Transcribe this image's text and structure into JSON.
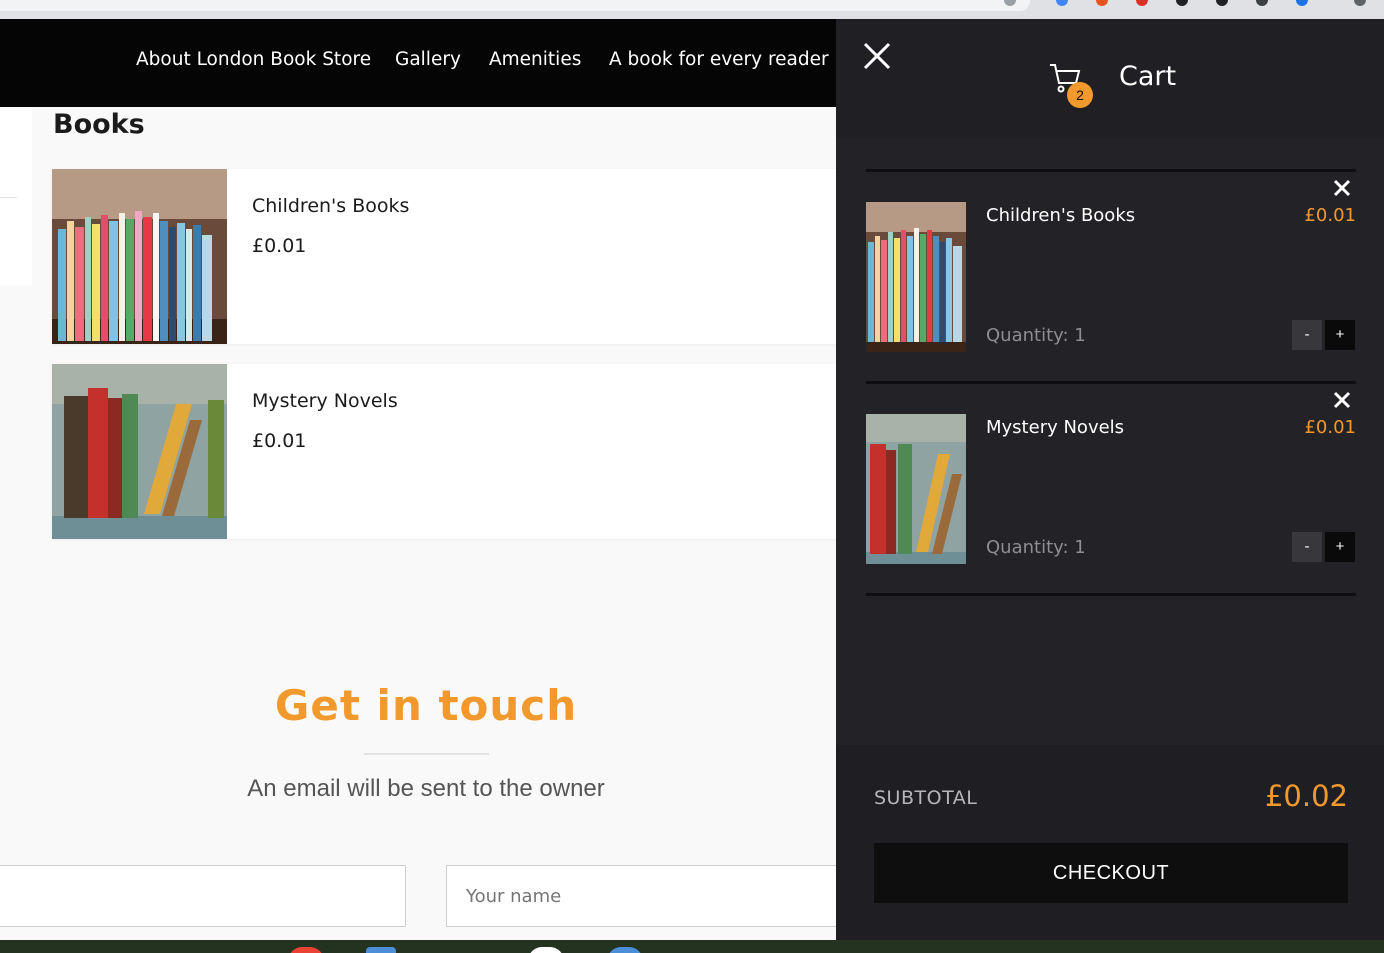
{
  "nav": {
    "items": [
      {
        "label": "About London Book Store"
      },
      {
        "label": "Gallery"
      },
      {
        "label": "Amenities"
      },
      {
        "label": "A book for every reader"
      }
    ]
  },
  "main": {
    "section_title": "Books",
    "products": [
      {
        "name": "Children's Books",
        "price": "£0.01",
        "image": "colorful-childrens-books-on-shelf"
      },
      {
        "name": "Mystery Novels",
        "price": "£0.01",
        "image": "old-books-on-wooden-shelf"
      }
    ]
  },
  "contact": {
    "title": "Get in touch",
    "subtitle": "An email will be sent to the owner",
    "name_placeholder": "Your name"
  },
  "cart": {
    "title": "Cart",
    "badge_count": "2",
    "items": [
      {
        "name": "Children's Books",
        "price": "£0.01",
        "quantity_label": "Quantity: 1",
        "minus": "-",
        "plus": "+"
      },
      {
        "name": "Mystery Novels",
        "price": "£0.01",
        "quantity_label": "Quantity: 1",
        "minus": "-",
        "plus": "+"
      }
    ],
    "subtotal_label": "SUBTOTAL",
    "subtotal_value": "£0.02",
    "checkout_label": "CHECKOUT"
  },
  "colors": {
    "accent": "#f2992d",
    "drawer_bg": "#232327",
    "header_bg": "#050505"
  },
  "icons": [
    "close-icon",
    "cart-icon",
    "remove-item-icon"
  ]
}
